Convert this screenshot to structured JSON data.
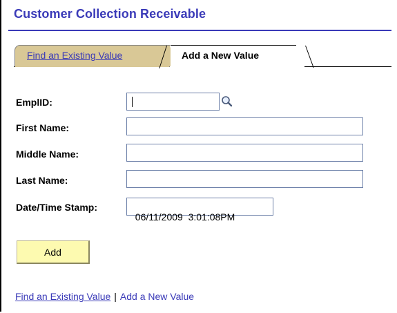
{
  "page": {
    "title": "Customer Collection Receivable"
  },
  "tabs": [
    {
      "label": "Find an Existing Value",
      "active": false
    },
    {
      "label": "Add a New Value",
      "active": true
    }
  ],
  "form": {
    "emplid": {
      "label": "EmplID:",
      "value": ""
    },
    "first_name": {
      "label": "First Name:",
      "value": ""
    },
    "middle_name": {
      "label": "Middle Name:",
      "value": ""
    },
    "last_name": {
      "label": "Last Name:",
      "value": ""
    },
    "datetime": {
      "label": "Date/Time Stamp:",
      "value": "06/11/2009  3:01:08PM"
    }
  },
  "actions": {
    "add_label": "Add"
  },
  "links": {
    "find": "Find an Existing Value",
    "separator": "|",
    "add_new": "Add a New Value"
  },
  "icons": {
    "lookup": "magnifier-icon"
  },
  "colors": {
    "title": "#3a3ab8",
    "inactive_tab": "#d9c896",
    "add_button": "#fdfab0"
  }
}
